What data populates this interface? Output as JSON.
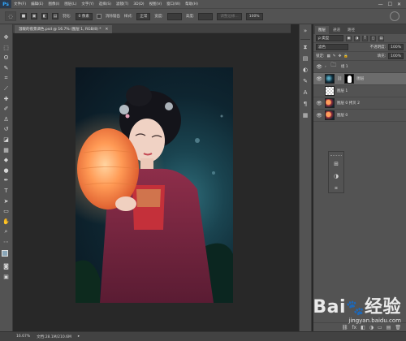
{
  "app": {
    "logo": "Ps"
  },
  "menubar": {
    "items": [
      "文件(F)",
      "编辑(E)",
      "图像(I)",
      "图层(L)",
      "文字(Y)",
      "选择(S)",
      "滤镜(T)",
      "3D(D)",
      "视图(V)",
      "窗口(W)",
      "帮助(H)"
    ],
    "controls": [
      "—",
      "☐",
      "✕"
    ]
  },
  "options_bar": {
    "feather_label": "羽化:",
    "feather_value": "0 像素",
    "style_label": "样式:",
    "style_value": "正常",
    "antialias_label": "消除锯齿",
    "width_label": "宽度:",
    "height_label": "高度:",
    "refine_edge_label": "调整边缘...",
    "zoom_field": "100%"
  },
  "document": {
    "tab_title": "温暖的夜景调色.psd @ 16.7% (图层 1, RGB/8) *",
    "tab_close": "✕"
  },
  "status": {
    "zoom": "16.67%",
    "doc_info": "文档:28.1M/210.6M"
  },
  "layers_panel": {
    "tabs": [
      "图层",
      "通道",
      "路径"
    ],
    "filter_kind": "ρ 类型",
    "blend_mode": "滤色",
    "opacity_label": "不透明度:",
    "opacity_value": "100%",
    "lock_label": "锁定:",
    "fill_label": "填充:",
    "fill_value": "100%",
    "layers": [
      {
        "name": "组 1",
        "type": "group",
        "visible": true,
        "selected": false
      },
      {
        "name": "图层",
        "type": "masked",
        "visible": true,
        "selected": true
      },
      {
        "name": "图层 1",
        "type": "transparent",
        "visible": false,
        "selected": false
      },
      {
        "name": "图层 0 拷贝 2",
        "type": "photo",
        "visible": true,
        "selected": false
      },
      {
        "name": "图层 0",
        "type": "photo",
        "visible": true,
        "selected": false
      }
    ],
    "footer_icons": [
      "⛓",
      "fx",
      "◧",
      "◑",
      "▭",
      "▤",
      "🗑"
    ]
  },
  "watermark": {
    "brand": "Bai",
    "brand_cn": "经验",
    "url": "jingyan.baidu.com"
  },
  "colors": {
    "fg": "#8aa6b8",
    "bg": "#ffffff"
  }
}
